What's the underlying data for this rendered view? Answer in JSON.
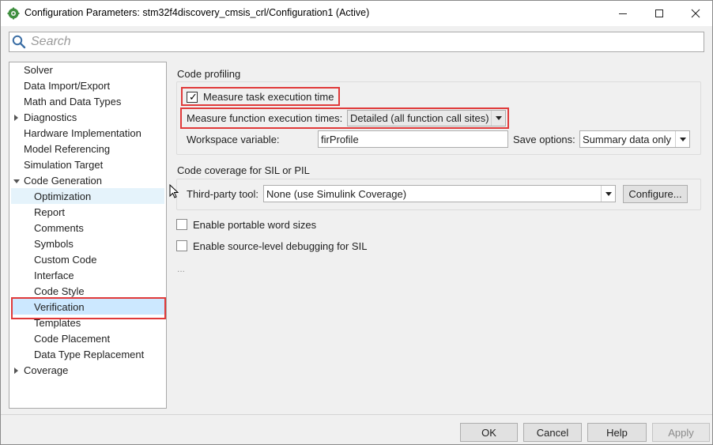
{
  "window": {
    "title": "Configuration Parameters: stm32f4discovery_cmsis_crl/Configuration1 (Active)",
    "controls": {
      "minimize": "—",
      "maximize": "☐",
      "close": "✕"
    }
  },
  "search": {
    "placeholder": "Search"
  },
  "tree": {
    "items": [
      {
        "label": "Solver",
        "expander": "none"
      },
      {
        "label": "Data Import/Export",
        "expander": "none"
      },
      {
        "label": "Math and Data Types",
        "expander": "none"
      },
      {
        "label": "Diagnostics",
        "expander": "collapsed"
      },
      {
        "label": "Hardware Implementation",
        "expander": "none"
      },
      {
        "label": "Model Referencing",
        "expander": "none"
      },
      {
        "label": "Simulation Target",
        "expander": "none"
      },
      {
        "label": "Code Generation",
        "expander": "expanded"
      },
      {
        "label": "Optimization",
        "expander": "none"
      },
      {
        "label": "Report",
        "expander": "none"
      },
      {
        "label": "Comments",
        "expander": "none"
      },
      {
        "label": "Symbols",
        "expander": "none"
      },
      {
        "label": "Custom Code",
        "expander": "none"
      },
      {
        "label": "Interface",
        "expander": "none"
      },
      {
        "label": "Code Style",
        "expander": "none"
      },
      {
        "label": "Verification",
        "expander": "none"
      },
      {
        "label": "Templates",
        "expander": "none"
      },
      {
        "label": "Code Placement",
        "expander": "none"
      },
      {
        "label": "Data Type Replacement",
        "expander": "none"
      },
      {
        "label": "Coverage",
        "expander": "collapsed"
      }
    ],
    "selected": "Verification",
    "hovered": "Optimization"
  },
  "profiling": {
    "section_title": "Code profiling",
    "measure_task_label": "Measure task execution time",
    "measure_task_checked": true,
    "measure_function_label": "Measure function execution times:",
    "measure_function_value": "Detailed (all function call sites)",
    "workspace_label": "Workspace variable:",
    "workspace_value": "firProfile",
    "save_options_label": "Save options:",
    "save_options_value": "Summary data only"
  },
  "coverage": {
    "section_title": "Code coverage for SIL or PIL",
    "third_party_label": "Third-party tool:",
    "third_party_value": "None (use Simulink Coverage)",
    "configure_label": "Configure..."
  },
  "options": {
    "portable_word_sizes_label": "Enable portable word sizes",
    "portable_word_sizes_checked": false,
    "source_debug_label": "Enable source-level debugging for SIL",
    "source_debug_checked": false,
    "more_label": "..."
  },
  "buttons": {
    "ok": "OK",
    "cancel": "Cancel",
    "help": "Help",
    "apply": "Apply"
  },
  "colors": {
    "highlight": "#e03a3a",
    "selection": "#cce8ff",
    "hover": "#e5f3fb"
  }
}
